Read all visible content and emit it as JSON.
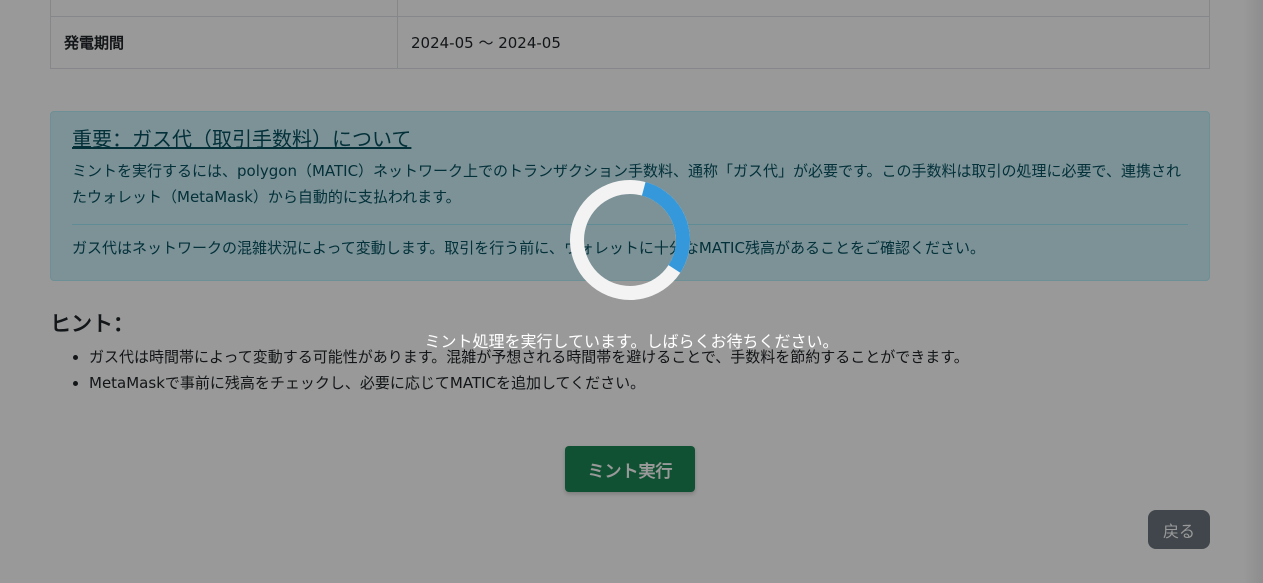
{
  "table": {
    "period_label": "発電期間",
    "period_value": "2024-05 〜 2024-05"
  },
  "alert": {
    "title": "重要：ガス代（取引手数料）について",
    "paragraph1": "ミントを実行するには、polygon（MATIC）ネットワーク上でのトランザクション手数料、通称「ガス代」が必要です。この手数料は取引の処理に必要で、連携されたウォレット（MetaMask）から自動的に支払われます。",
    "paragraph2": "ガス代はネットワークの混雑状況によって変動します。取引を行う前に、ウォレットに十分なMATIC残高があることをご確認ください。"
  },
  "hints": {
    "title": "ヒント：",
    "items": [
      "ガス代は時間帯によって変動する可能性があります。混雑が予想される時間帯を避けることで、手数料を節約することができます。",
      "MetaMaskで事前に残高をチェックし、必要に応じてMATICを追加してください。"
    ]
  },
  "buttons": {
    "mint_label": "ミント実行",
    "back_label": "戻る"
  },
  "loading": {
    "message": "ミント処理を実行しています。しばらくお待ちください。",
    "progress_fraction": 0.3
  },
  "colors": {
    "alert_bg": "#cff4fc",
    "alert_text": "#055160",
    "mint_button": "#198754",
    "back_button": "#6c757d",
    "spinner_track": "#f3f3f3",
    "spinner_arc": "#3498db"
  }
}
